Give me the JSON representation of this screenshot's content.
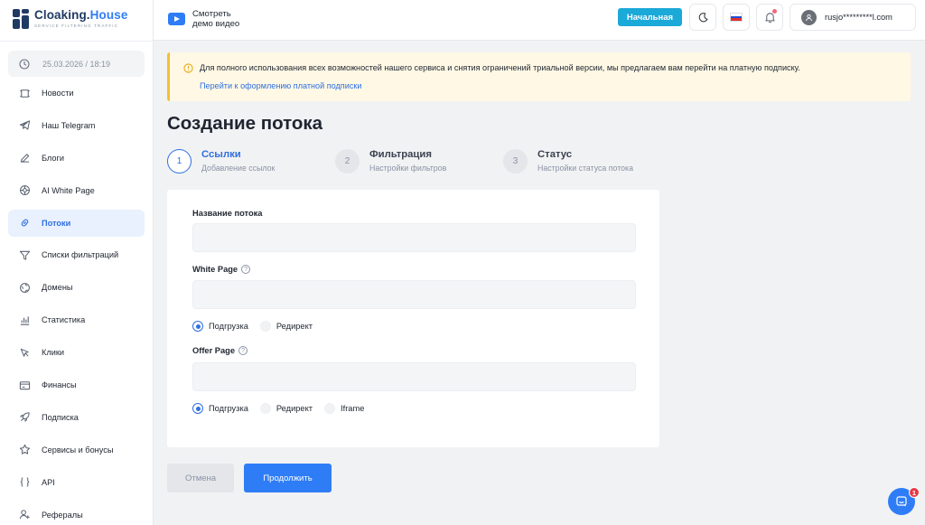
{
  "brand": {
    "name_main": "Cloaking.",
    "name_accent": "House",
    "tagline": "SERVICE FILTERING TRAFFIC",
    "color_primary": "#1f3a63",
    "color_accent": "#2f7df6"
  },
  "sidebar": {
    "datetime": "25.03.2026 / 18:19",
    "items": [
      {
        "label": "Новости",
        "icon": "news-icon"
      },
      {
        "label": "Наш Telegram",
        "icon": "telegram-icon"
      },
      {
        "label": "Блоги",
        "icon": "pen-icon"
      },
      {
        "label": "AI White Page",
        "icon": "ai-icon"
      },
      {
        "label": "Потоки",
        "icon": "link-icon",
        "active": true
      },
      {
        "label": "Списки фильтраций",
        "icon": "filter-icon"
      },
      {
        "label": "Домены",
        "icon": "globe-icon"
      },
      {
        "label": "Статистика",
        "icon": "chart-icon"
      },
      {
        "label": "Клики",
        "icon": "cursor-icon"
      },
      {
        "label": "Финансы",
        "icon": "wallet-icon"
      },
      {
        "label": "Подписка",
        "icon": "rocket-icon"
      },
      {
        "label": "Сервисы и бонусы",
        "icon": "star-icon"
      },
      {
        "label": "API",
        "icon": "braces-icon"
      },
      {
        "label": "Рефералы",
        "icon": "user-plus-icon"
      }
    ]
  },
  "header": {
    "demo_line1": "Смотреть",
    "demo_line2": "демо видео",
    "plan_label": "Начальная",
    "plan_color": "#1ba9d8",
    "user_email": "rusjo*********l.com"
  },
  "alert": {
    "text": "Для полного использования всех возможностей нашего сервиса и снятия ограничений триальной версии, мы предлагаем вам перейти на платную подписку.",
    "link": "Перейти к оформлению платной подписки"
  },
  "page": {
    "title": "Создание потока"
  },
  "steps": [
    {
      "number": "1",
      "title": "Ссылки",
      "subtitle": "Добавление ссылок",
      "active": true
    },
    {
      "number": "2",
      "title": "Фильтрация",
      "subtitle": "Настройки фильтров",
      "active": false
    },
    {
      "number": "3",
      "title": "Статус",
      "subtitle": "Настройки статуса потока",
      "active": false
    }
  ],
  "form": {
    "stream_name_label": "Название потока",
    "stream_name_value": "",
    "white_page_label": "White Page",
    "white_page_value": "",
    "white_page_modes": [
      "Подгрузка",
      "Редирект"
    ],
    "white_page_selected": "Подгрузка",
    "offer_page_label": "Offer Page",
    "offer_page_value": "",
    "offer_page_modes": [
      "Подгрузка",
      "Редирект",
      "Iframe"
    ],
    "offer_page_selected": "Подгрузка",
    "help_glyph": "?"
  },
  "actions": {
    "cancel_label": "Отмена",
    "continue_label": "Продолжить"
  },
  "chat": {
    "badge_count": "1"
  }
}
